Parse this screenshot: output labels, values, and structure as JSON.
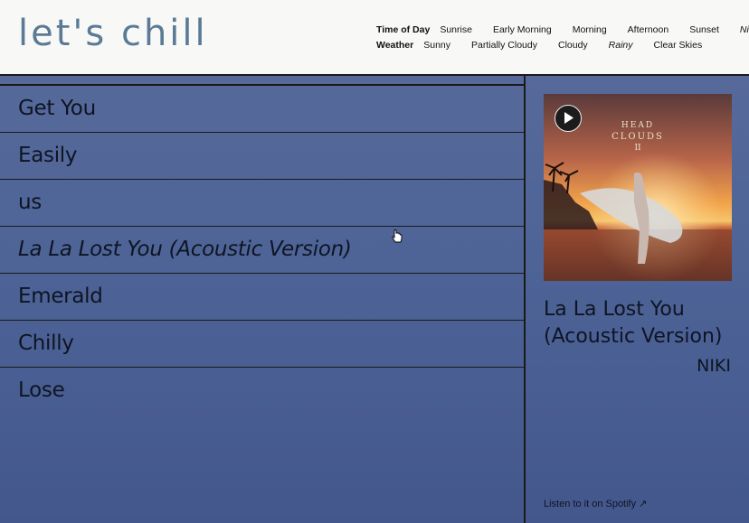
{
  "app": {
    "logo": "let's chill"
  },
  "filters": {
    "time_of_day": {
      "label": "Time of Day",
      "options": [
        "Sunrise",
        "Early Morning",
        "Morning",
        "Afternoon",
        "Sunset",
        "Night"
      ],
      "selected": "Night"
    },
    "weather": {
      "label": "Weather",
      "options": [
        "Sunny",
        "Partially Cloudy",
        "Cloudy",
        "Rainy",
        "Clear Skies"
      ],
      "selected": "Rainy"
    }
  },
  "tracks": [
    "Get You",
    "Easily",
    "us",
    "La La Lost You (Acoustic Version)",
    "Emerald",
    "Chilly",
    "Lose"
  ],
  "active_track": "La La Lost You (Acoustic Version)",
  "now_playing": {
    "title": "La La Lost You (Acoustic Version)",
    "artist": "NIKI",
    "album_art_text": [
      "HEAD",
      "CLOUDS",
      "II"
    ],
    "spotify_link": "Listen to it on Spotify ↗"
  },
  "colors": {
    "logo": "#5a7a95",
    "background": "#4a5f8f",
    "header": "#f8f8f6"
  }
}
